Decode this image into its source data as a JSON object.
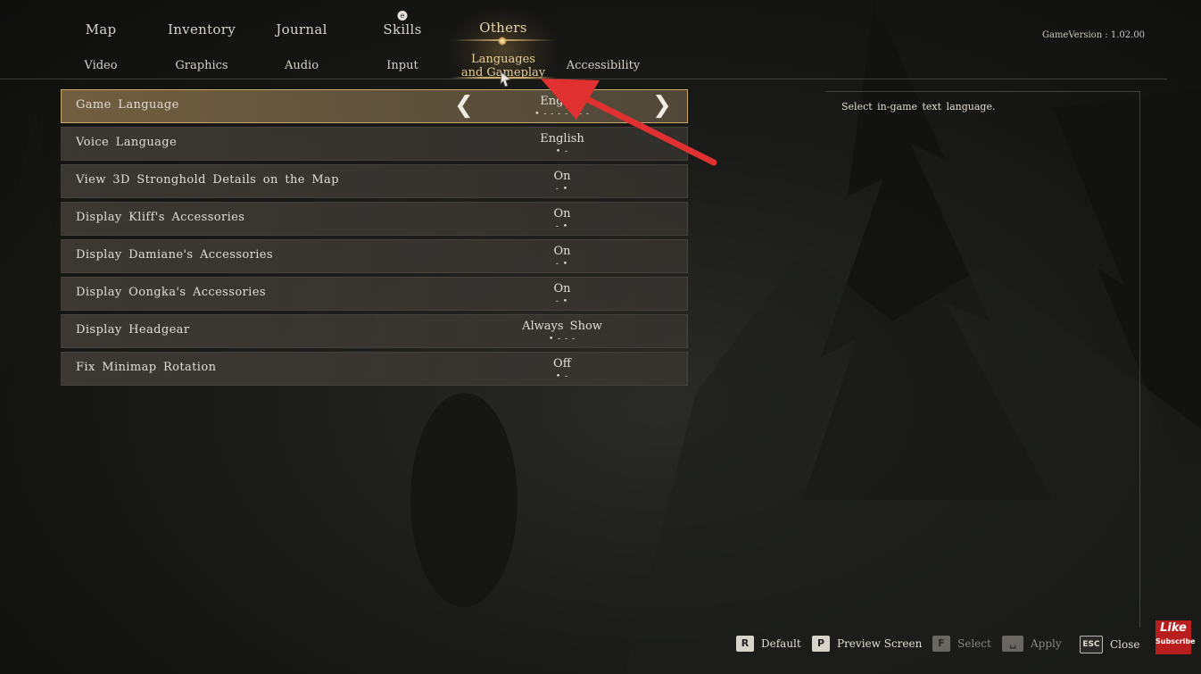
{
  "main_tabs": [
    {
      "label": "Map"
    },
    {
      "label": "Inventory"
    },
    {
      "label": "Journal"
    },
    {
      "label": "Skills"
    },
    {
      "label": "Others"
    }
  ],
  "sub_tabs": [
    {
      "label": "Video"
    },
    {
      "label": "Graphics"
    },
    {
      "label": "Audio"
    },
    {
      "label": "Input"
    },
    {
      "label": "Languages and Gameplay"
    },
    {
      "label": "Accessibility"
    }
  ],
  "active_main_tab": "Others",
  "active_sub_tab": "Languages and Gameplay",
  "game_version": "GameVersion : 1.02.00",
  "settings": [
    {
      "label": "Game Language",
      "value": "English",
      "dots": "• - - - - - - -"
    },
    {
      "label": "Voice Language",
      "value": "English",
      "dots": "• -"
    },
    {
      "label": "View 3D Stronghold Details on the Map",
      "value": "On",
      "dots": "- •"
    },
    {
      "label": "Display Kliff's Accessories",
      "value": "On",
      "dots": "- •"
    },
    {
      "label": "Display Damiane's Accessories",
      "value": "On",
      "dots": "- •"
    },
    {
      "label": "Display Oongka's Accessories",
      "value": "On",
      "dots": "- •"
    },
    {
      "label": "Display Headgear",
      "value": "Always Show",
      "dots": "• - - -"
    },
    {
      "label": "Fix Minimap Rotation",
      "value": "Off",
      "dots": "• -"
    }
  ],
  "description": "Select in-game text language.",
  "footer": {
    "default": {
      "key": "R",
      "label": "Default"
    },
    "preview": {
      "key": "P",
      "label": "Preview Screen"
    },
    "select": {
      "key": "F",
      "label": "Select"
    },
    "apply": {
      "key": "␣",
      "label": "Apply"
    },
    "close": {
      "key": "ESC",
      "label": "Close"
    }
  },
  "badge": {
    "line1": "Like",
    "line2": "Subscribe"
  },
  "colors": {
    "accent": "#c9a86a",
    "annotation_arrow": "#e03030",
    "badge": "#b81e1e"
  }
}
